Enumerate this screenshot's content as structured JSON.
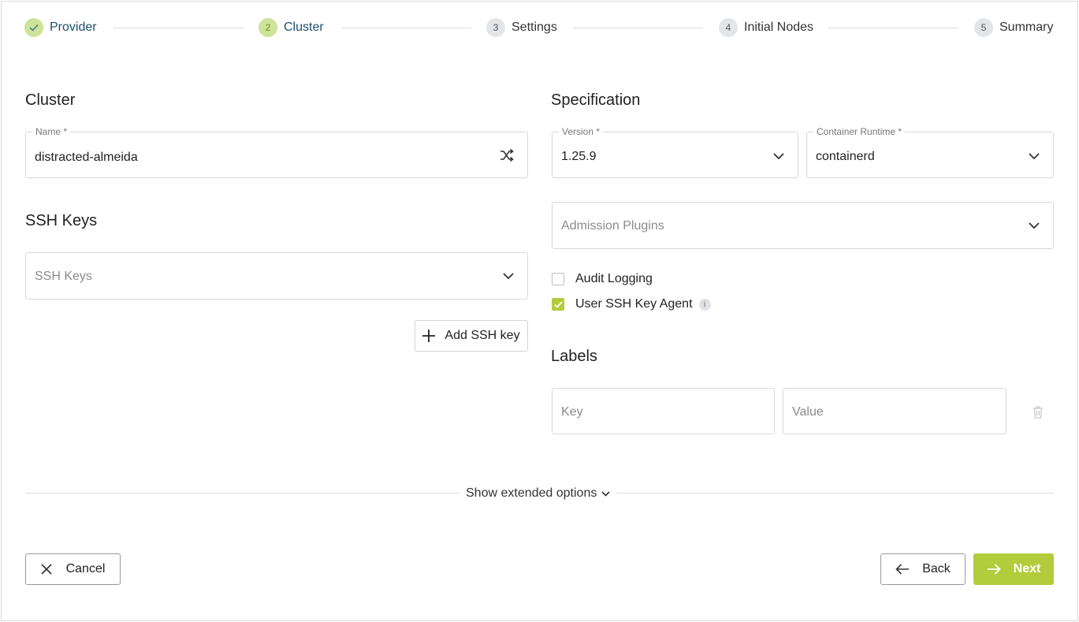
{
  "stepper": {
    "steps": [
      {
        "number": "1",
        "label": "Provider",
        "state": "done"
      },
      {
        "number": "2",
        "label": "Cluster",
        "state": "active"
      },
      {
        "number": "3",
        "label": "Settings",
        "state": "pending"
      },
      {
        "number": "4",
        "label": "Initial Nodes",
        "state": "pending"
      },
      {
        "number": "5",
        "label": "Summary",
        "state": "pending"
      }
    ]
  },
  "cluster": {
    "title": "Cluster",
    "name_label": "Name *",
    "name_value": "distracted-almeida",
    "name_icon": "shuffle-icon"
  },
  "ssh": {
    "title": "SSH Keys",
    "select_placeholder": "SSH Keys",
    "add_button": "Add SSH key"
  },
  "spec": {
    "title": "Specification",
    "version_label": "Version *",
    "version_value": "1.25.9",
    "runtime_label": "Container Runtime *",
    "runtime_value": "containerd",
    "admission_placeholder": "Admission Plugins",
    "audit_logging_label": "Audit Logging",
    "audit_logging_checked": false,
    "ssh_agent_label": "User SSH Key Agent",
    "ssh_agent_checked": true,
    "info_glyph": "i"
  },
  "labels": {
    "title": "Labels",
    "key_placeholder": "Key",
    "value_placeholder": "Value",
    "delete_icon": "trash-icon"
  },
  "extended": {
    "label": "Show extended options"
  },
  "footer": {
    "cancel": "Cancel",
    "back": "Back",
    "next": "Next"
  },
  "colors": {
    "accent": "#b3cc3c",
    "accent_light": "#cfe29a",
    "stepper_text_active": "#1c4f6b"
  }
}
